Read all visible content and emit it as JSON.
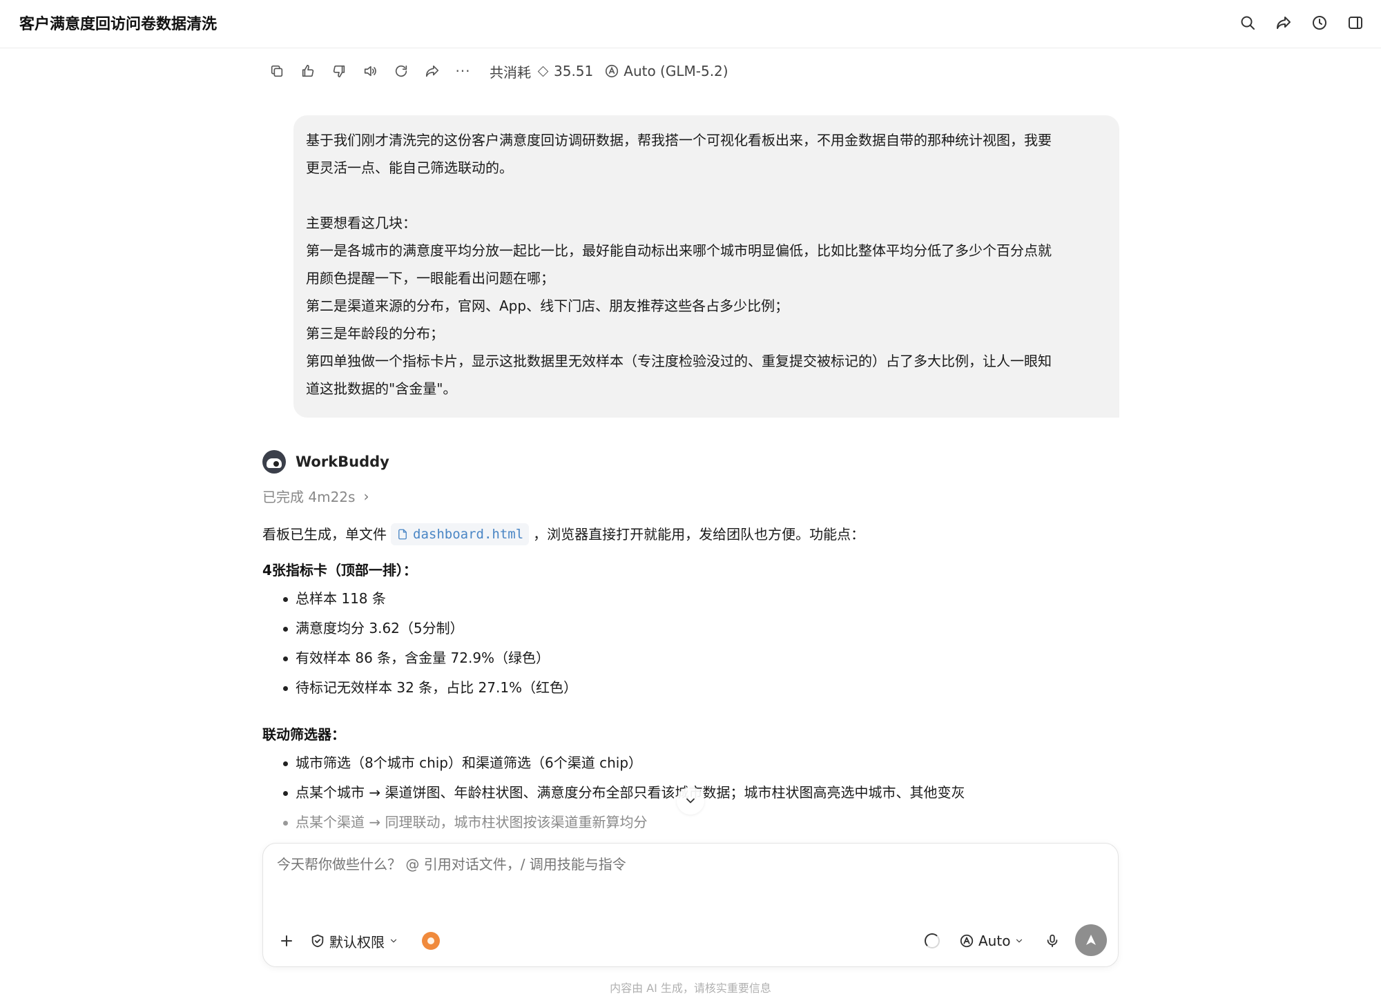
{
  "header": {
    "title": "客户满意度回访问卷数据清洗",
    "tools": [
      "search-icon",
      "share-icon",
      "history-icon",
      "sidebar-toggle-icon"
    ]
  },
  "message_actions": {
    "icons": [
      "copy-icon",
      "thumbs-up-icon",
      "thumbs-down-icon",
      "speaker-icon",
      "regenerate-icon",
      "forward-icon",
      "more-icon"
    ],
    "more_label": "···",
    "cost_label": "共消耗",
    "cost_value": "35.51",
    "model_label": "Auto (GLM-5.2)"
  },
  "user_message": {
    "text": "基于我们刚才清洗完的这份客户满意度回访调研数据，帮我搭一个可视化看板出来，不用金数据自带的那种统计视图，我要\n更灵活一点、能自己筛选联动的。\n\n主要想看这几块：\n第一是各城市的满意度平均分放一起比一比，最好能自动标出来哪个城市明显偏低，比如比整体平均分低了多少个百分点就\n用颜色提醒一下，一眼能看出问题在哪；\n第二是渠道来源的分布，官网、App、线下门店、朋友推荐这些各占多少比例；\n第三是年龄段的分布；\n第四单独做一个指标卡片，显示这批数据里无效样本（专注度检验没过的、重复提交被标记的）占了多大比例，让人一眼知\n道这批数据的\"含金量\"。"
  },
  "assistant": {
    "name": "WorkBuddy",
    "status": "已完成 4m22s",
    "intro_before": "看板已生成，单文件",
    "file_name": "dashboard.html",
    "intro_after": "，浏览器直接打开就能用，发给团队也方便。功能点：",
    "sections": [
      {
        "heading": "4张指标卡（顶部一排）：",
        "items": [
          "总样本 118 条",
          "满意度均分 3.62（5分制）",
          "有效样本 86 条，含金量 72.9%（绿色）",
          "待标记无效样本 32 条，占比 27.1%（红色）"
        ]
      },
      {
        "heading": "联动筛选器：",
        "items": [
          "城市筛选（8个城市 chip）和渠道筛选（6个渠道 chip）",
          "点某个城市 → 渠道饼图、年龄柱状图、满意度分布全部只看该城市数据；城市柱状图高亮选中城市、其他变灰",
          "点某个渠道 → 同理联动，城市柱状图按该渠道重新算均分"
        ]
      }
    ]
  },
  "composer": {
    "placeholder": "今天帮你做些什么？ @ 引用对话文件，/ 调用技能与指令",
    "permission_label": "默认权限",
    "model_label": "Auto"
  },
  "footer": {
    "note": "内容由 AI 生成，请核实重要信息"
  }
}
